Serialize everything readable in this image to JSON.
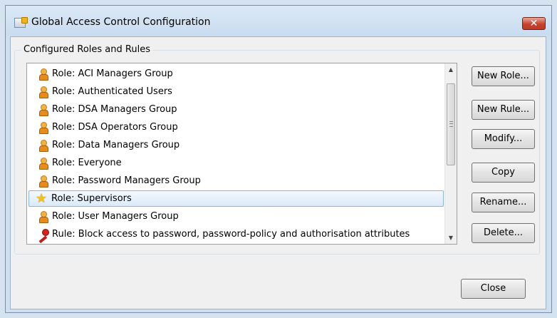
{
  "window": {
    "title": "Global Access Control Configuration",
    "close_glyph": "✕"
  },
  "group": {
    "label": "Configured Roles and Rules"
  },
  "items": [
    {
      "icon": "role-person-icon",
      "label": "Role: ACI Managers Group"
    },
    {
      "icon": "role-person-icon",
      "label": "Role: Authenticated Users"
    },
    {
      "icon": "role-person-icon",
      "label": "Role: DSA Managers Group"
    },
    {
      "icon": "role-person-icon",
      "label": "Role: DSA Operators Group"
    },
    {
      "icon": "role-person-icon",
      "label": "Role: Data Managers Group"
    },
    {
      "icon": "role-person-icon",
      "label": "Role: Everyone"
    },
    {
      "icon": "role-person-icon",
      "label": "Role: Password Managers Group"
    },
    {
      "icon": "star-icon",
      "label": "Role: Supervisors",
      "selected": true
    },
    {
      "icon": "role-person-icon",
      "label": "Role: User Managers Group"
    },
    {
      "icon": "rule-key-icon",
      "label": "Rule: Block access to password, password-policy and authorisation attributes"
    }
  ],
  "buttons": {
    "new_role": "New Role...",
    "new_rule": "New Rule...",
    "modify": "Modify...",
    "copy": "Copy",
    "rename": "Rename...",
    "delete": "Delete...",
    "close": "Close"
  },
  "scrollbar": {
    "up_glyph": "▲",
    "down_glyph": "▼"
  },
  "colors": {
    "selection_border": "#8fb2db",
    "title_close_red": "#c8422e"
  }
}
